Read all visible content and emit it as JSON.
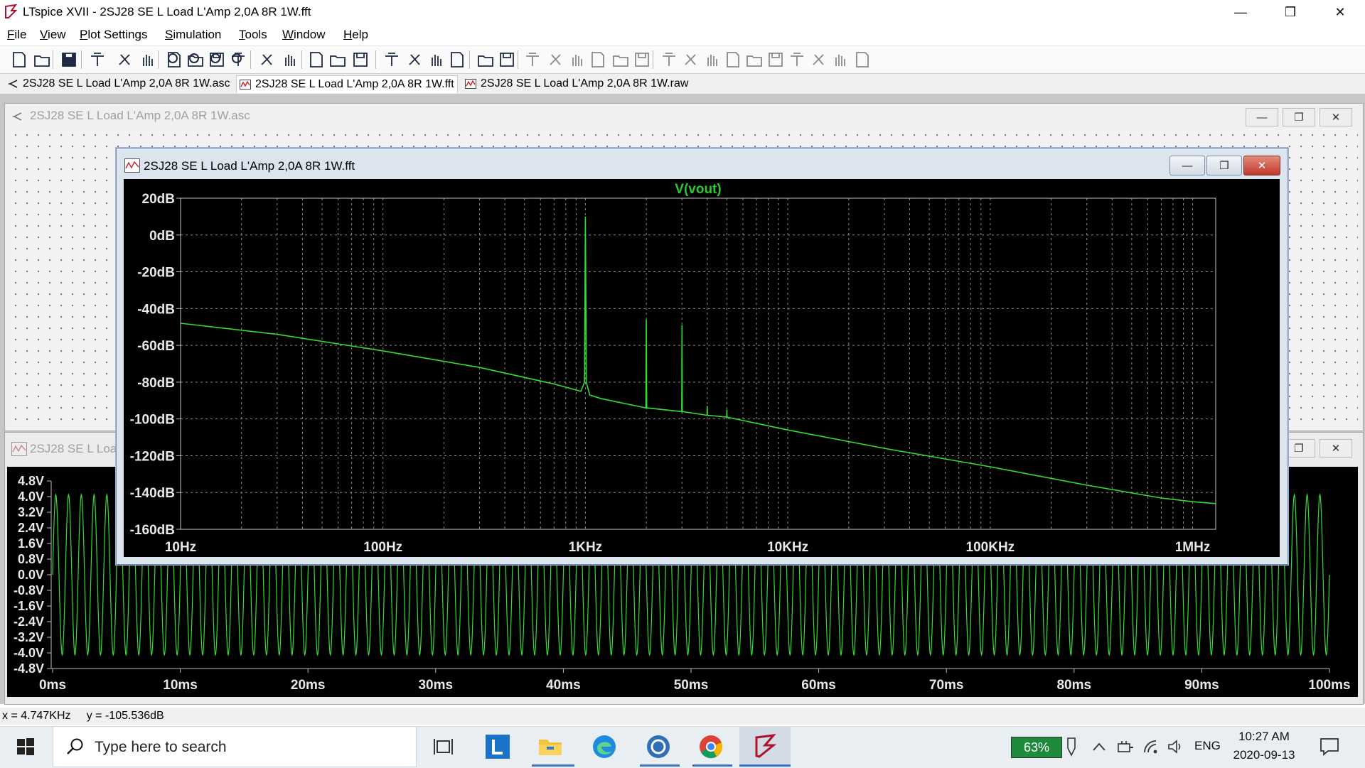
{
  "window": {
    "title": "LTspice XVII - 2SJ28 SE L Load L'Amp 2,0A 8R 1W.fft",
    "minimize_glyph": "—",
    "restore_glyph": "❐",
    "close_glyph": "✕"
  },
  "menu": {
    "items": [
      {
        "underlined": "F",
        "rest": "ile"
      },
      {
        "underlined": "V",
        "rest": "iew"
      },
      {
        "underlined": "P",
        "rest": "lot Settings"
      },
      {
        "underlined": "S",
        "rest": "imulation"
      },
      {
        "underlined": "T",
        "rest": "ools"
      },
      {
        "underlined": "W",
        "rest": "indow"
      },
      {
        "underlined": "H",
        "rest": "elp"
      }
    ]
  },
  "toolbar": {
    "icons": [
      "new-schematic-icon",
      "open-icon",
      "save-icon",
      "control-panel-icon",
      "run-icon",
      "pan-icon",
      "zoom-in-icon",
      "zoom-full-icon",
      "zoom-out-icon",
      "zoom-cancel-icon",
      "autorange-icon",
      "plot-settings-icon",
      "tile-horizontal-icon",
      "cascade-icon",
      "tile-vertical-icon",
      "cut-icon",
      "copy-icon",
      "paste-icon",
      "find-icon",
      "print-icon",
      "print-setup-icon",
      "wire-icon",
      "ground-icon",
      "label-icon",
      "resistor-icon",
      "capacitor-icon",
      "inductor-icon",
      "diode-icon",
      "component-icon",
      "move-icon",
      "drag-icon",
      "undo-icon",
      "redo-icon",
      "rotate-icon",
      "mirror-icon",
      "text-icon",
      "spice-directive-icon"
    ]
  },
  "tabs": [
    {
      "label": "2SJ28 SE L Load L'Amp 2,0A 8R 1W.asc",
      "icon": "schematic-icon",
      "active": false
    },
    {
      "label": "2SJ28 SE L Load L'Amp 2,0A 8R 1W.fft",
      "icon": "waveform-icon",
      "active": true
    },
    {
      "label": "2SJ28 SE L Load L'Amp 2,0A 8R 1W.raw",
      "icon": "waveform-icon",
      "active": false
    }
  ],
  "asc_window": {
    "title": "2SJ28 SE L Load L'Amp 2,0A 8R 1W.asc"
  },
  "raw_window": {
    "title": "2SJ28 SE L Loa"
  },
  "fft_window": {
    "title": "2SJ28 SE L Load L'Amp 2,0A 8R 1W.fft"
  },
  "colors": {
    "trace": "#33dd33",
    "plot_bg": "#000000",
    "title_green": "#2cc82c",
    "grid": "#8a8a8a"
  },
  "chart_data": [
    {
      "type": "line",
      "title": "V(vout)",
      "x_scale": "log",
      "xlim": [
        10,
        1300000
      ],
      "ylim": [
        -160,
        20
      ],
      "yticks": [
        "20dB",
        "0dB",
        "-20dB",
        "-40dB",
        "-60dB",
        "-80dB",
        "-100dB",
        "-120dB",
        "-140dB",
        "-160dB"
      ],
      "ytick_values": [
        20,
        0,
        -20,
        -40,
        -60,
        -80,
        -100,
        -120,
        -140,
        -160
      ],
      "xticks": [
        "10Hz",
        "100Hz",
        "1KHz",
        "10KHz",
        "100KHz",
        "1MHz"
      ],
      "xtick_values": [
        10,
        100,
        1000,
        10000,
        100000,
        1000000
      ],
      "series": [
        {
          "x": [
            10,
            30,
            100,
            300,
            700,
            950,
            990,
            1000,
            1010,
            1050,
            1200,
            1990,
            2000,
            2010,
            2990,
            3000,
            3010,
            3990,
            4000,
            4010,
            4990,
            5000,
            5010,
            10000,
            30000,
            100000,
            300000,
            700000,
            1000000,
            1300000
          ],
          "y": [
            -48,
            -54,
            -63,
            -72,
            -81,
            -85,
            -80,
            10,
            -80,
            -87,
            -89,
            -94,
            -46,
            -94,
            -96,
            -49,
            -96,
            -98,
            -93,
            -98,
            -99,
            -95,
            -99,
            -106,
            -116,
            -126,
            -136,
            -143,
            -145,
            -146
          ]
        }
      ]
    },
    {
      "type": "line",
      "title": "",
      "xlim": [
        0,
        100
      ],
      "ylim": [
        -4.8,
        4.8
      ],
      "yticks": [
        "4.8V",
        "4.0V",
        "3.2V",
        "2.4V",
        "1.6V",
        "0.8V",
        "0.0V",
        "-0.8V",
        "-1.6V",
        "-2.4V",
        "-3.2V",
        "-4.0V",
        "-4.8V"
      ],
      "ytick_values": [
        4.8,
        4.0,
        3.2,
        2.4,
        1.6,
        0.8,
        0.0,
        -0.8,
        -1.6,
        -2.4,
        -3.2,
        -4.0,
        -4.8
      ],
      "xticks": [
        "0ms",
        "10ms",
        "20ms",
        "30ms",
        "40ms",
        "50ms",
        "60ms",
        "70ms",
        "80ms",
        "90ms",
        "100ms"
      ],
      "xtick_values": [
        0,
        10,
        20,
        30,
        40,
        50,
        60,
        70,
        80,
        90,
        100
      ],
      "series": [
        {
          "frequency_hz": 1000,
          "amplitude_v": 4.1,
          "x_unit": "ms"
        }
      ]
    }
  ],
  "status": {
    "text": "x = 4.747KHz     y = -105.536dB"
  },
  "taskbar": {
    "search_placeholder": "Type here to search",
    "battery": "63%",
    "language": "ENG",
    "time": "10:27 AM",
    "date": "2020-09-13"
  }
}
